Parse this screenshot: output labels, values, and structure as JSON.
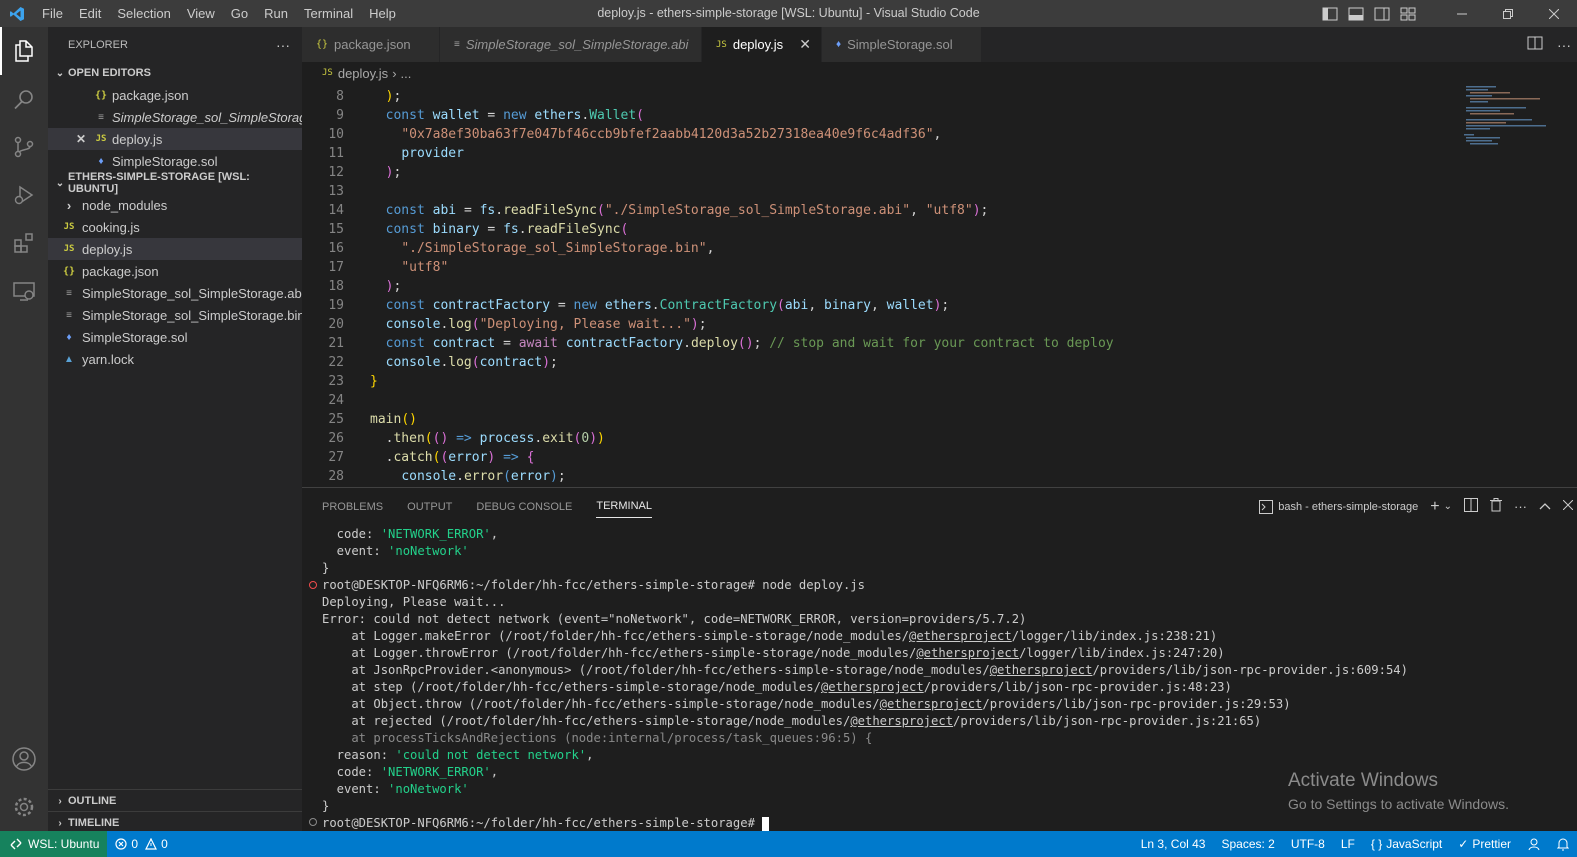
{
  "titlebar": {
    "menu": [
      "File",
      "Edit",
      "Selection",
      "View",
      "Go",
      "Run",
      "Terminal",
      "Help"
    ],
    "title": "deploy.js - ethers-simple-storage [WSL: Ubuntu] - Visual Studio Code"
  },
  "sidebar": {
    "header": "EXPLORER",
    "more": "···",
    "open_editors": {
      "label": "OPEN EDITORS",
      "items": [
        {
          "icon": "{}",
          "name": "package.json"
        },
        {
          "icon": "≡",
          "name": "SimpleStorage_sol_SimpleStorag..."
        },
        {
          "icon": "JS",
          "name": "deploy.js",
          "close": "✕"
        },
        {
          "icon": "♦",
          "name": "SimpleStorage.sol"
        }
      ]
    },
    "workspace": {
      "label": "ETHERS-SIMPLE-STORAGE [WSL: UBUNTU]",
      "items": [
        {
          "icon": "›",
          "name": "node_modules"
        },
        {
          "icon": "JS",
          "name": "cooking.js"
        },
        {
          "icon": "JS",
          "name": "deploy.js"
        },
        {
          "icon": "{}",
          "name": "package.json"
        },
        {
          "icon": "≡",
          "name": "SimpleStorage_sol_SimpleStorage.abi"
        },
        {
          "icon": "≡",
          "name": "SimpleStorage_sol_SimpleStorage.bin"
        },
        {
          "icon": "♦",
          "name": "SimpleStorage.sol"
        },
        {
          "icon": "▲",
          "name": "yarn.lock"
        }
      ]
    },
    "outline": "OUTLINE",
    "timeline": "TIMELINE"
  },
  "tabs": [
    {
      "icon": "{}",
      "label": "package.json"
    },
    {
      "icon": "≡",
      "label": "SimpleStorage_sol_SimpleStorage.abi"
    },
    {
      "icon": "JS",
      "label": "deploy.js",
      "close": "✕"
    },
    {
      "icon": "♦",
      "label": "SimpleStorage.sol"
    }
  ],
  "breadcrumb": {
    "icon": "JS",
    "file": "deploy.js",
    "sep": "›",
    "rest": "..."
  },
  "editor": {
    "line_numbers": [
      "8",
      "9",
      "10",
      "11",
      "12",
      "13",
      "14",
      "15",
      "16",
      "17",
      "18",
      "19",
      "20",
      "21",
      "22",
      "23",
      "24",
      "25",
      "26",
      "27",
      "28"
    ]
  },
  "panel": {
    "tabs": [
      "PROBLEMS",
      "OUTPUT",
      "DEBUG CONSOLE",
      "TERMINAL"
    ],
    "terminal_name": "bash - ethers-simple-storage",
    "terminal_lines": [
      "  code: 'NETWORK_ERROR',",
      "  event: 'noNetwork'",
      "}",
      "root@DESKTOP-NFQ6RM6:~/folder/hh-fcc/ethers-simple-storage# node deploy.js",
      "Deploying, Please wait...",
      "Error: could not detect network (event=\"noNetwork\", code=NETWORK_ERROR, version=providers/5.7.2)",
      "    at Logger.makeError (/root/folder/hh-fcc/ethers-simple-storage/node_modules/@ethersproject/logger/lib/index.js:238:21)",
      "    at Logger.throwError (/root/folder/hh-fcc/ethers-simple-storage/node_modules/@ethersproject/logger/lib/index.js:247:20)",
      "    at JsonRpcProvider.<anonymous> (/root/folder/hh-fcc/ethers-simple-storage/node_modules/@ethersproject/providers/lib/json-rpc-provider.js:609:54)",
      "    at step (/root/folder/hh-fcc/ethers-simple-storage/node_modules/@ethersproject/providers/lib/json-rpc-provider.js:48:23)",
      "    at Object.throw (/root/folder/hh-fcc/ethers-simple-storage/node_modules/@ethersproject/providers/lib/json-rpc-provider.js:29:53)",
      "    at rejected (/root/folder/hh-fcc/ethers-simple-storage/node_modules/@ethersproject/providers/lib/json-rpc-provider.js:21:65)",
      "    at processTicksAndRejections (node:internal/process/task_queues:96:5) {",
      "  reason: 'could not detect network',",
      "  code: 'NETWORK_ERROR',",
      "  event: 'noNetwork'",
      "}",
      "root@DESKTOP-NFQ6RM6:~/folder/hh-fcc/ethers-simple-storage# "
    ]
  },
  "watermark": {
    "line1": "Activate Windows",
    "line2": "Go to Settings to activate Windows."
  },
  "statusbar": {
    "remote": "WSL: Ubuntu",
    "errors": "0",
    "warnings": "0",
    "position": "Ln 3, Col 43",
    "spaces": "Spaces: 2",
    "encoding": "UTF-8",
    "eol": "LF",
    "language": "JavaScript",
    "prettier": "Prettier"
  },
  "colors": {
    "accent": "#007acc",
    "remote": "#16825d",
    "titlebar": "#3c3c3c",
    "sidebar": "#252526",
    "editor": "#1e1e1e"
  }
}
